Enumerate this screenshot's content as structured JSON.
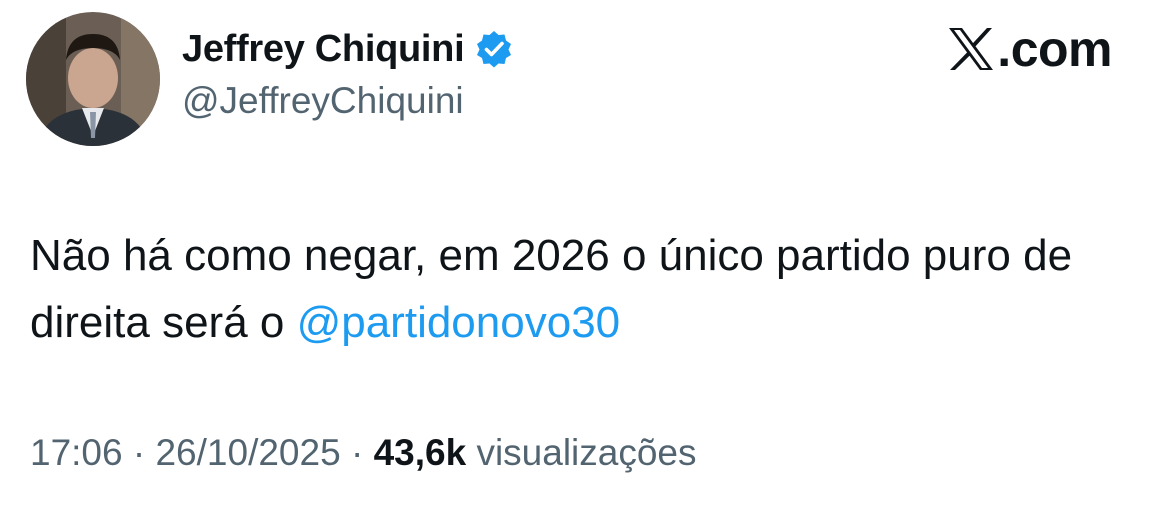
{
  "author": {
    "display_name": "Jeffrey Chiquini",
    "handle": "@JeffreyChiquini",
    "verified": true,
    "avatar_icon": "profile-photo"
  },
  "site": {
    "logo_icon": "x-logo-icon",
    "logo_text": "X",
    "suffix": ".com"
  },
  "tweet": {
    "text_before_mention": "Não há como negar, em 2026 o único partido puro de direita será o ",
    "mention": "@partidonovo30"
  },
  "meta": {
    "time": "17:06",
    "separator": " · ",
    "date": "26/10/2025",
    "views_count": "43,6k",
    "views_label": "visualizações"
  },
  "colors": {
    "text": "#0f1419",
    "secondary": "#536471",
    "link": "#1d9bf0",
    "verified_badge": "#1d9bf0"
  }
}
